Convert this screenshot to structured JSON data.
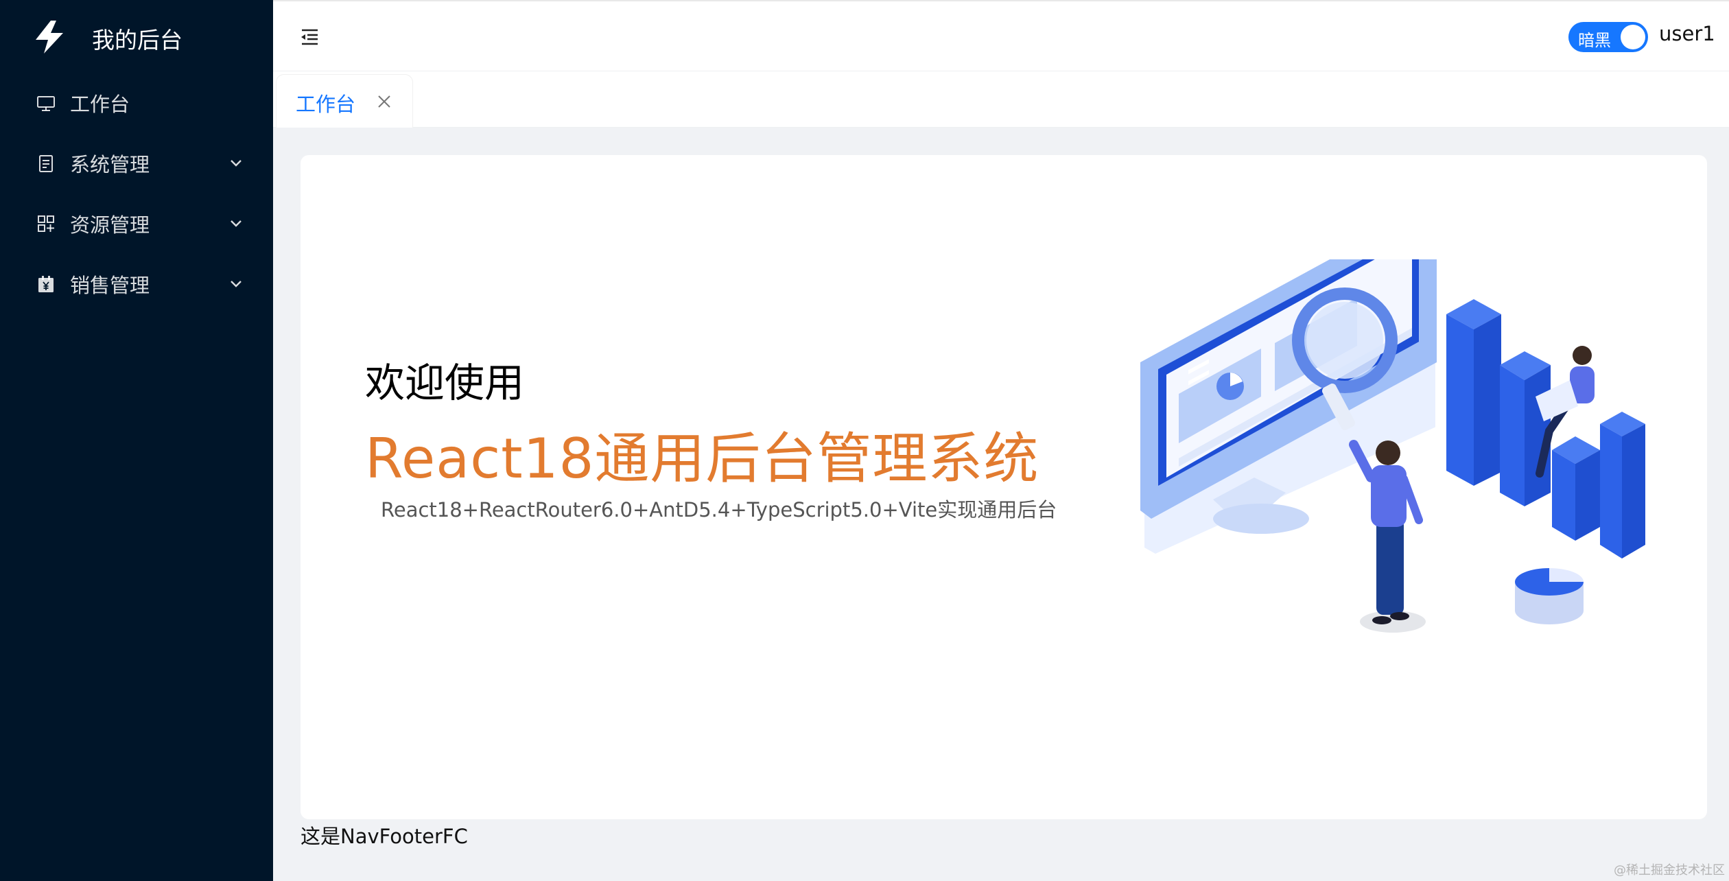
{
  "sidebar": {
    "logo_text": "我的后台",
    "logo_icon": "thunderbolt-icon",
    "items": [
      {
        "label": "工作台",
        "icon": "desktop-icon",
        "has_children": false
      },
      {
        "label": "系统管理",
        "icon": "file-icon",
        "has_children": true
      },
      {
        "label": "资源管理",
        "icon": "appstore-icon",
        "has_children": true
      },
      {
        "label": "销售管理",
        "icon": "yuan-calendar-icon",
        "has_children": true
      }
    ]
  },
  "header": {
    "collapse_icon": "menu-fold-icon",
    "theme_switch": {
      "label": "暗黑",
      "checked": true
    },
    "username": "user1"
  },
  "tabs": [
    {
      "label": "工作台",
      "active": true,
      "closable": true
    }
  ],
  "content": {
    "welcome": "欢迎使用",
    "title": "React18通用后台管理系统",
    "subtitle": "React18+ReactRouter6.0+AntD5.4+TypeScript5.0+Vite实现通用后台",
    "illustration": "data-analysis-illustration"
  },
  "footer": {
    "text": "这是NavFooterFC"
  },
  "watermark": "@稀土掘金技术社区",
  "colors": {
    "sider_bg": "#001529",
    "accent": "#1677ff",
    "title_orange": "#e27b2f",
    "content_bg": "#f0f2f5"
  }
}
